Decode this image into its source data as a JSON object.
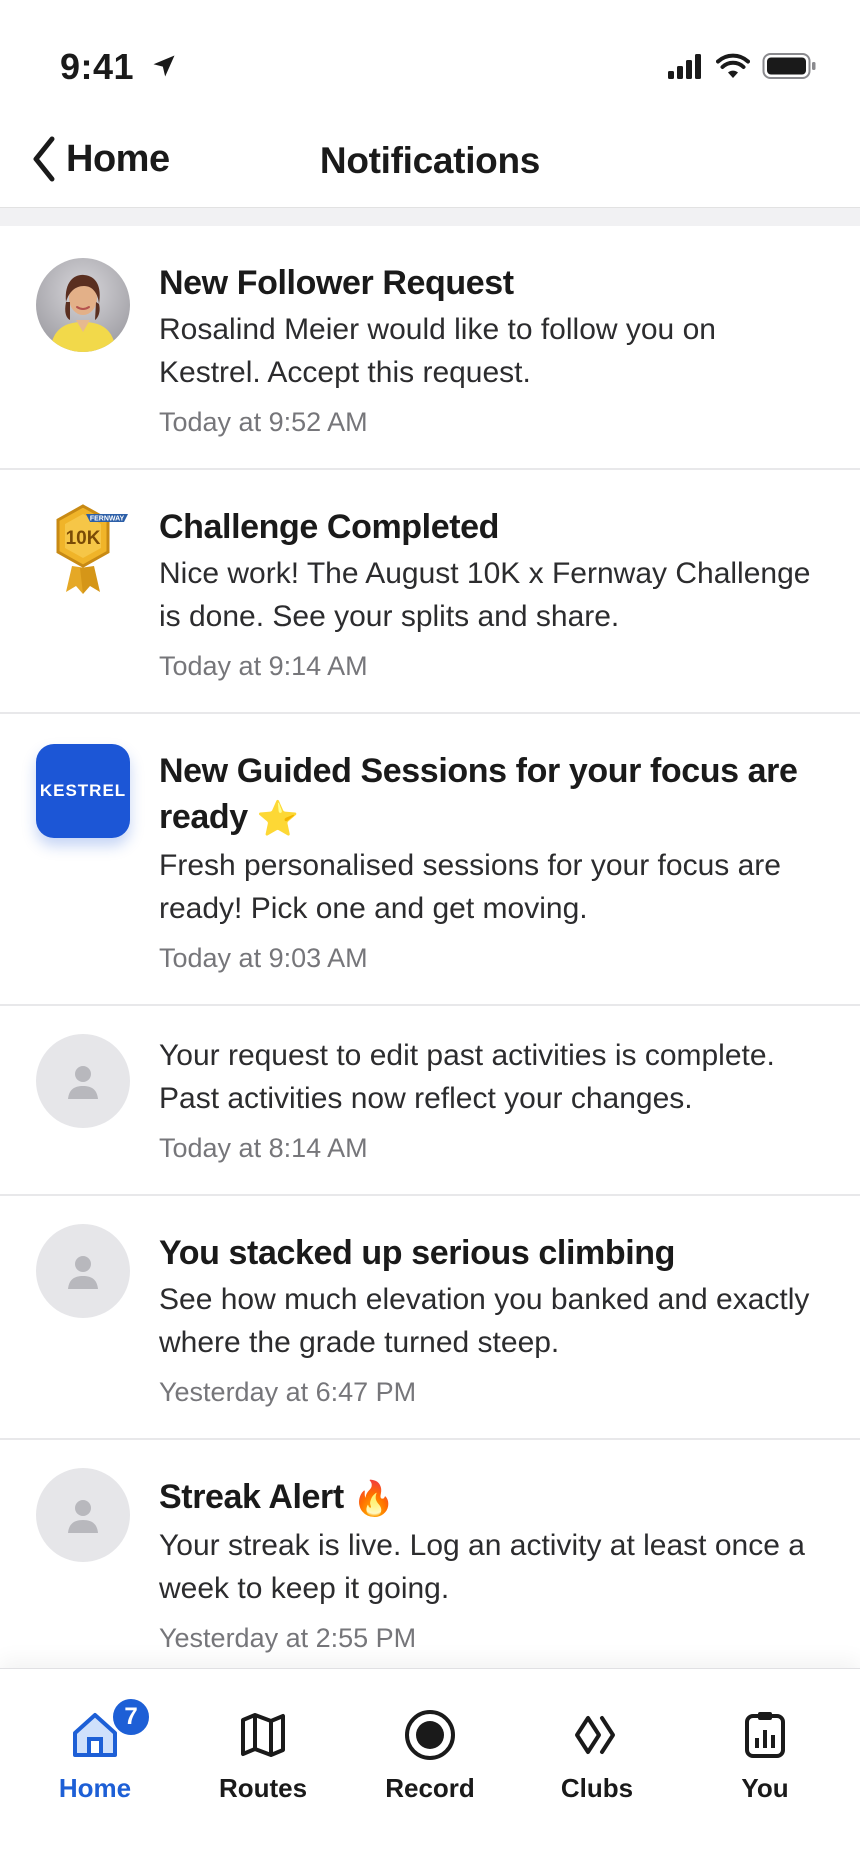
{
  "status_bar": {
    "time": "9:41"
  },
  "header": {
    "back_label": "Home",
    "title": "Notifications"
  },
  "notifications": [
    {
      "title": "New Follower Request",
      "body": "Rosalind Meier would like to follow you on Kestrel. Accept this request.",
      "time": "Today at 9:52 AM",
      "avatar": "profile-photo"
    },
    {
      "title": "Challenge Completed",
      "body": "Nice work! The August 10K x Fernway Challenge is done. See your splits and share.",
      "time": "Today at 9:14 AM",
      "avatar": "challenge-badge",
      "badge_text": "10K",
      "badge_ribbon": "FERNWAY"
    },
    {
      "title": "New Guided Sessions for your focus are ready",
      "title_emoji": "⭐",
      "body": "Fresh personalised sessions for your focus are ready! Pick one and get moving.",
      "time": "Today at 9:03 AM",
      "avatar": "app-logo",
      "app_logo_text": "KESTREL"
    },
    {
      "title": "",
      "body": "Your request to edit past activities is complete. Past activities now reflect your changes.",
      "time": "Today at 8:14 AM",
      "avatar": "generic"
    },
    {
      "title": "You stacked up serious climbing",
      "body": "See how much elevation you banked and exactly where the grade turned steep.",
      "time": "Yesterday at 6:47 PM",
      "avatar": "generic"
    },
    {
      "title": "Streak Alert",
      "title_emoji": "🔥",
      "body": "Your streak is live. Log an activity at least once a week to keep it going.",
      "time": "Yesterday at 2:55 PM",
      "avatar": "generic"
    }
  ],
  "tabbar": {
    "tabs": [
      {
        "label": "Home",
        "icon": "home-icon",
        "active": true,
        "badge": "7"
      },
      {
        "label": "Routes",
        "icon": "map-icon"
      },
      {
        "label": "Record",
        "icon": "record-icon"
      },
      {
        "label": "Clubs",
        "icon": "clubs-icon"
      },
      {
        "label": "You",
        "icon": "profile-stats-icon"
      }
    ]
  },
  "colors": {
    "accent": "#1d5fd6",
    "app_logo": "#1c56d6",
    "divider": "#e8e8ea"
  }
}
